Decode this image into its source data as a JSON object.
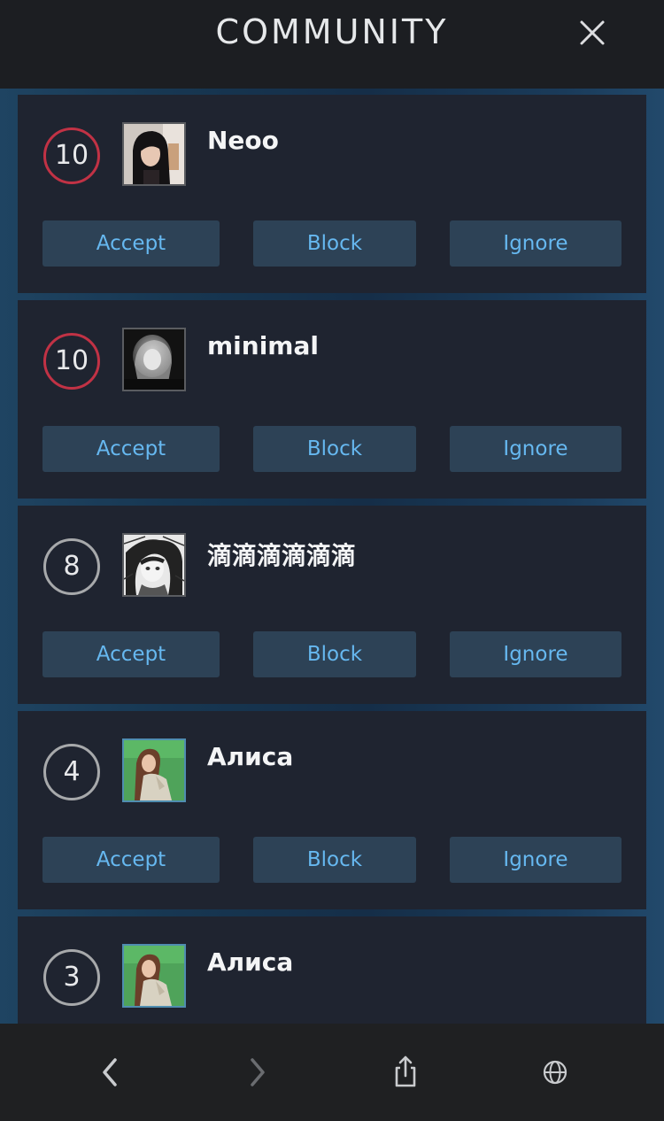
{
  "header": {
    "title": "COMMUNITY",
    "close_icon": "close-icon"
  },
  "buttons": {
    "accept": "Accept",
    "block": "Block",
    "ignore": "Ignore"
  },
  "requests": [
    {
      "count": "10",
      "name": "Neoo",
      "count_color": "#c13245",
      "avatar": "avatar-photo-girl-dark"
    },
    {
      "count": "10",
      "name": "minimal",
      "count_color": "#c13245",
      "avatar": "avatar-photo-grayscale"
    },
    {
      "count": "8",
      "name": "滴滴滴滴滴滴",
      "count_color": "#a7a9ab",
      "avatar": "avatar-anime-sketch"
    },
    {
      "count": "4",
      "name": "Алиса",
      "count_color": "#a7a9ab",
      "avatar": "avatar-photo-green"
    },
    {
      "count": "3",
      "name": "Алиса",
      "count_color": "#a7a9ab",
      "avatar": "avatar-photo-green"
    }
  ],
  "bottom_nav": {
    "back_icon": "chevron-left-icon",
    "forward_icon": "chevron-right-icon",
    "share_icon": "share-icon",
    "globe_icon": "globe-icon"
  },
  "colors": {
    "accent_text": "#66b8f0",
    "button_bg": "#2d4256",
    "card_bg": "#1f2430",
    "hot_ring": "#c13245"
  }
}
